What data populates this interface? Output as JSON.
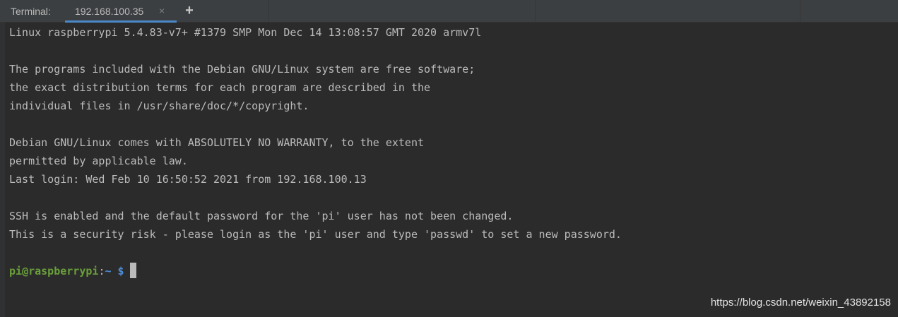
{
  "tool_window": {
    "label": "Terminal:"
  },
  "tabs": [
    {
      "label": "192.168.100.35",
      "close_glyph": "×",
      "active": true
    }
  ],
  "add_tab_glyph": "+",
  "colors": {
    "background": "#2b2b2b",
    "tab_bar": "#3c3f41",
    "tab_underline": "#4a88c7",
    "text": "#bbbbbb",
    "prompt_user": "#6a9f3b",
    "prompt_path": "#4f8ed6"
  },
  "terminal": {
    "lines": [
      "Linux raspberrypi 5.4.83-v7+ #1379 SMP Mon Dec 14 13:08:57 GMT 2020 armv7l",
      "",
      "The programs included with the Debian GNU/Linux system are free software;",
      "the exact distribution terms for each program are described in the",
      "individual files in /usr/share/doc/*/copyright.",
      "",
      "Debian GNU/Linux comes with ABSOLUTELY NO WARRANTY, to the extent",
      "permitted by applicable law.",
      "Last login: Wed Feb 10 16:50:52 2021 from 192.168.100.13",
      "",
      "SSH is enabled and the default password for the 'pi' user has not been changed.",
      "This is a security risk - please login as the 'pi' user and type 'passwd' to set a new password.",
      ""
    ],
    "prompt": {
      "user_host": "pi@raspberrypi",
      "separator": ":",
      "path": "~",
      "symbol": "$"
    }
  },
  "watermark": "https://blog.csdn.net/weixin_43892158"
}
